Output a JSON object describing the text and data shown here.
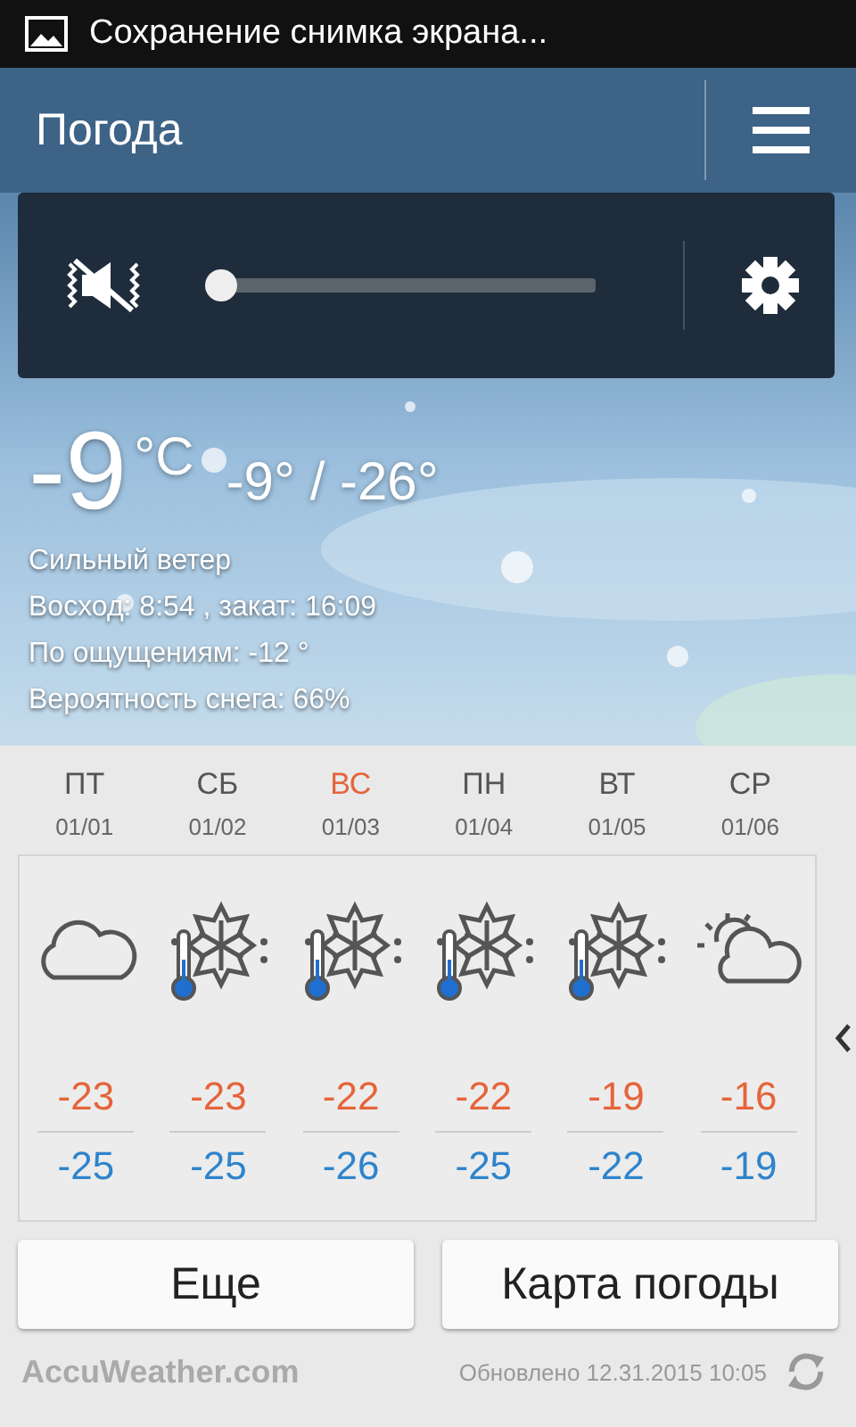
{
  "status_bar": {
    "notification": "Сохранение снимка экрана..."
  },
  "app_bar": {
    "title": "Погода"
  },
  "volume_panel": {
    "muted": true,
    "level": 0.0
  },
  "current": {
    "temp": "-9",
    "unit": "°C",
    "high_low": "-9° / -26°",
    "details": [
      "Сильный ветер",
      "Восход: 8:54 , закат: 16:09",
      "По ощущениям: -12 °",
      "Вероятность снега: 66%"
    ]
  },
  "forecast": [
    {
      "day": "ПТ",
      "date": "01/01",
      "holiday": false,
      "kind": "cloudy",
      "high": "-23",
      "low": "-25"
    },
    {
      "day": "СБ",
      "date": "01/02",
      "holiday": false,
      "kind": "snow-cold",
      "high": "-23",
      "low": "-25"
    },
    {
      "day": "ВС",
      "date": "01/03",
      "holiday": true,
      "kind": "snow-cold",
      "high": "-22",
      "low": "-26"
    },
    {
      "day": "ПН",
      "date": "01/04",
      "holiday": false,
      "kind": "snow-cold",
      "high": "-22",
      "low": "-25"
    },
    {
      "day": "ВТ",
      "date": "01/05",
      "holiday": false,
      "kind": "snow-cold",
      "high": "-19",
      "low": "-22"
    },
    {
      "day": "СР",
      "date": "01/06",
      "holiday": false,
      "kind": "partly-cloudy",
      "high": "-16",
      "low": "-19"
    }
  ],
  "buttons": [
    "Еще",
    "Карта погоды"
  ],
  "footer": {
    "brand": "AccuWeather",
    "brand_suffix": ".com",
    "updated": "Обновлено 12.31.2015 10:05"
  }
}
